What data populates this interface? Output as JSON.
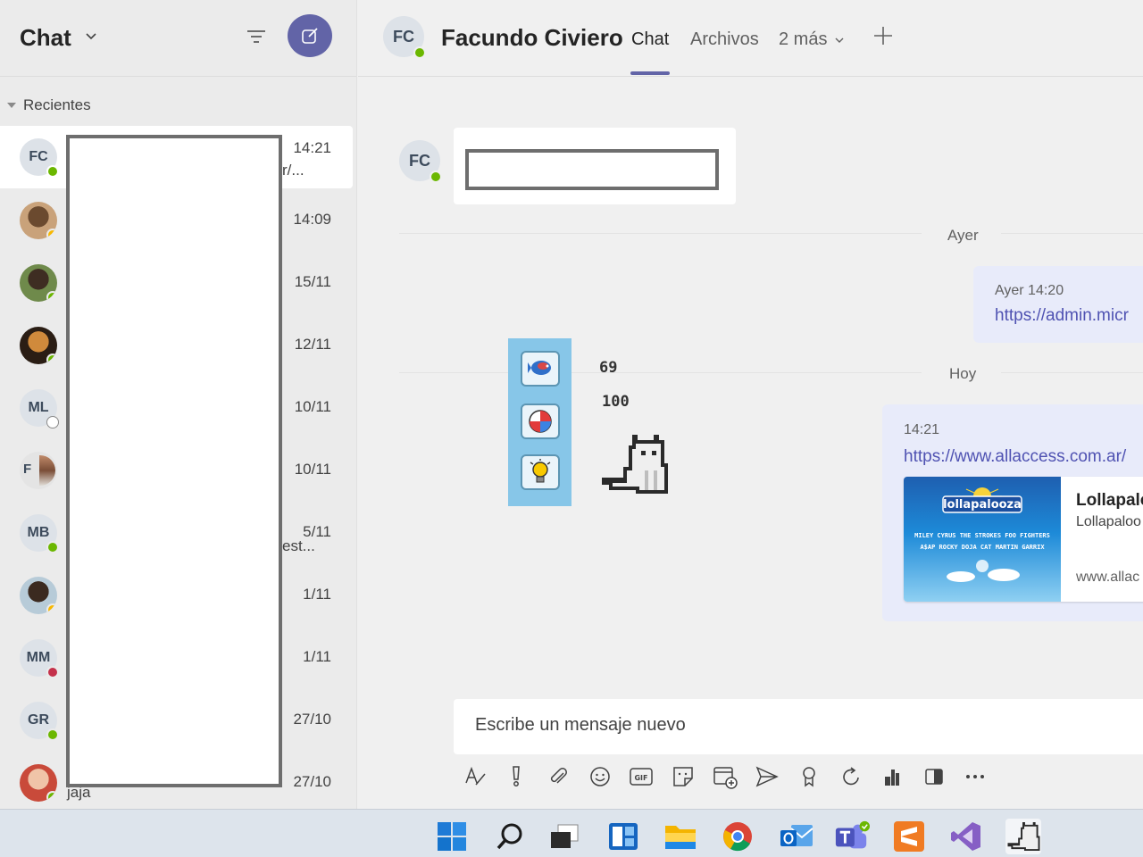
{
  "sidebar": {
    "title": "Chat",
    "recent_label": "Recientes",
    "chats": [
      {
        "initials": "FC",
        "time": "14:21",
        "preview": "r/...",
        "status": "available",
        "active": true
      },
      {
        "initials": "",
        "time": "14:09",
        "preview": "",
        "status": "away",
        "photo": "photo-woman"
      },
      {
        "initials": "",
        "time": "15/11",
        "preview": "",
        "status": "available",
        "photo": "photo-man-outdoor"
      },
      {
        "initials": "",
        "time": "12/11",
        "preview": "",
        "status": "available",
        "photo": "photo-sunset"
      },
      {
        "initials": "ML",
        "time": "10/11",
        "preview": "",
        "status": "offline"
      },
      {
        "initials": "F",
        "time": "10/11",
        "preview": "",
        "status": "none",
        "photo": "group"
      },
      {
        "initials": "MB",
        "time": "5/11",
        "preview": "est...",
        "status": "available"
      },
      {
        "initials": "",
        "time": "1/11",
        "preview": "",
        "status": "away",
        "photo": "photo-man-beard"
      },
      {
        "initials": "MM",
        "time": "1/11",
        "preview": "",
        "status": "busy"
      },
      {
        "initials": "GR",
        "time": "27/10",
        "preview": "",
        "status": "available"
      },
      {
        "initials": "",
        "time": "27/10",
        "preview": "jaja",
        "status": "available",
        "photo": "photo-woman-red"
      }
    ]
  },
  "header": {
    "avatar_initials": "FC",
    "name": "Facundo Civiero",
    "tabs": {
      "chat": "Chat",
      "files": "Archivos",
      "more": "2 más"
    }
  },
  "conversation": {
    "msg1": {
      "avatar_initials": "FC"
    },
    "divider_yesterday": "Ayer",
    "msg2": {
      "time": "Ayer 14:20",
      "link": "https://admin.micr"
    },
    "divider_today": "Hoy",
    "msg3": {
      "time": "14:21",
      "link": "https://www.allaccess.com.ar/",
      "card": {
        "title": "Lollapalo",
        "subtitle": "Lollapaloo",
        "url": "www.allac",
        "image_logo": "lollapalooza",
        "image_lines": [
          "MILEY CYRUS  THE STROKES  FOO FIGHTERS",
          "A$AP ROCKY  DOJA CAT  MARTIN GARRIX"
        ]
      }
    },
    "game_overlay": {
      "value1": "69",
      "value2": "100",
      "items": [
        "fish-icon",
        "beach-ball-icon",
        "lightbulb-icon"
      ]
    }
  },
  "composer": {
    "placeholder": "Escribe un mensaje nuevo"
  },
  "colors": {
    "accent": "#6264a7",
    "available": "#6bb700",
    "away": "#f8b800",
    "busy": "#c4314b",
    "link": "#4f52b2"
  }
}
